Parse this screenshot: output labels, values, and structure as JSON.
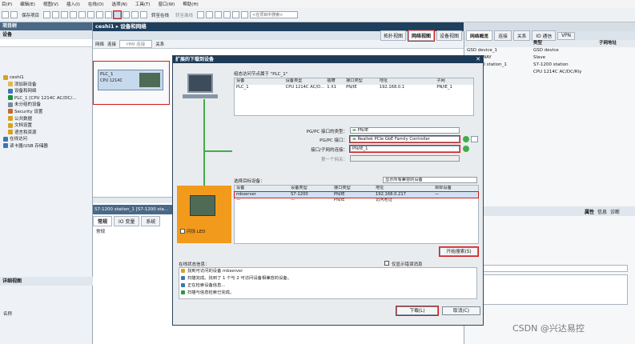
{
  "menu": [
    "目(P)",
    "编辑(E)",
    "视图(V)",
    "插入(I)",
    "在线(O)",
    "选项(N)",
    "工具(T)",
    "窗口(W)",
    "帮助(H)"
  ],
  "toolbar": {
    "save_label": "保存项目",
    "go_online": "转至在线",
    "go_offline": "转至离线",
    "search_placeholder": "<在项目中搜索>"
  },
  "left_panel": {
    "title": "项目树",
    "subtitle": "设备",
    "tree": [
      {
        "label": "ceshi1",
        "color": "#d9a21b"
      },
      {
        "label": "添加新设备",
        "color": "#e6b84a"
      },
      {
        "label": "设备和网络",
        "color": "#3c76b5"
      },
      {
        "label": "PLC_1 [CPU 1214C AC/DC/...",
        "color": "#1e8f3c"
      },
      {
        "label": "未分组的设备",
        "color": "#7a8a9a"
      },
      {
        "label": "Security 设置",
        "color": "#c26b2a"
      },
      {
        "label": "公共数据",
        "color": "#d9a21b"
      },
      {
        "label": "文档设置",
        "color": "#d9a21b"
      },
      {
        "label": "语言和资源",
        "color": "#d9a21b"
      },
      {
        "label": "在线访问",
        "color": "#3c76b5"
      },
      {
        "label": "读卡器/USB 存储器",
        "color": "#3c76b5"
      }
    ],
    "detail_title": "详细视图",
    "detail_col": "名称"
  },
  "center": {
    "breadcrumb": "ceshi1 ▸ 设备和网络",
    "view_tabs": [
      "拓扑视图",
      "网络视图",
      "设备视图"
    ],
    "toolbar": [
      "网络",
      "连接",
      "HMI 连接",
      "关系"
    ],
    "device": {
      "name": "PLC_1",
      "type": "CPU 1214C"
    },
    "bottom_title": "S7-1200 station_1 [S7-1200 sta...",
    "bottom_tabs": [
      "常规",
      "IO 变量",
      "系统"
    ],
    "bottom_item": "常规"
  },
  "right_panel": {
    "tabs": [
      "网络概览",
      "连接",
      "关系",
      "IO 通信",
      "VPN"
    ],
    "columns": [
      "",
      "类型",
      "子网地址"
    ],
    "rows": [
      {
        "device": "GSD device_1",
        "type": "GSD device"
      },
      {
        "device": "▸ GATEWAY",
        "type": "Slave"
      },
      {
        "device": "S7-1200 station_1",
        "type": "S7-1200 station"
      },
      {
        "device": "▸ PLC_1",
        "type": "CPU 1214C AC/DC/Rly"
      }
    ],
    "prop_tabs": [
      "属性",
      "信息",
      "诊断"
    ]
  },
  "dialog": {
    "title": "扩展的下载到设备",
    "config_caption": "组态访问节点属于 \"PLC_1\"",
    "config_headers": [
      "设备",
      "设备类型",
      "插槽",
      "接口类型",
      "地址",
      "子网"
    ],
    "config_row": [
      "PLC_1",
      "CPU 1214C AC/D...",
      "1 X1",
      "PN/IE",
      "192.168.0.1",
      "PN/IE_1"
    ],
    "pgpc_type_label": "PG/PC 接口的类型：",
    "pgpc_type_value": "PN/IE",
    "pgpc_if_label": "PG/PC 接口：",
    "pgpc_if_value": "Realtek PCIe GbE Family Controller",
    "conn_label": "接口/子网的连接：",
    "conn_value": "PN/IE_1",
    "gateway_label": "第一个网关：",
    "target_label": "选择目标设备：",
    "target_filter": "显示所有兼容的设备",
    "target_headers": [
      "设备",
      "设备类型",
      "接口类型",
      "地址",
      "目标设备"
    ],
    "target_rows": [
      [
        "mbserver",
        "S7-1200",
        "PN/IE",
        "192.168.0.217",
        "—"
      ],
      [
        "—",
        "—",
        "PN/IE",
        "访问地址",
        ""
      ]
    ],
    "flash_led": "闪烁 LED",
    "search_button": "开始搜索(S)",
    "status_label": "在线状态信息：",
    "errors_only": "仅显示错误消息",
    "status_lines": [
      {
        "text": "找到可访问的设备 mbserver",
        "color": "#d9a21b"
      },
      {
        "text": "扫描完成。找到了 1 个与 2 可访问设备相兼容的设备。",
        "color": "#3c76b5"
      },
      {
        "text": "正在检索设备信息...",
        "color": "#3c76b5"
      },
      {
        "text": "扫描与信息检索已完成。",
        "color": "#2a9a3c"
      }
    ],
    "download_button": "下载(L)",
    "cancel_button": "取消(C)"
  },
  "watermark": "CSDN @兴达易控"
}
